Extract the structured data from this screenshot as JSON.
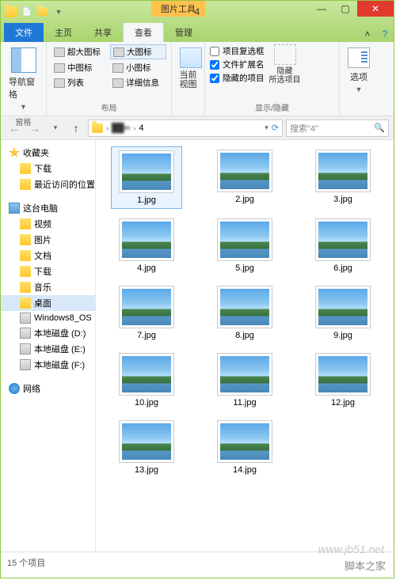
{
  "title": "4",
  "contextTab": "图片工具",
  "tabs": {
    "file": "文件",
    "home": "主页",
    "share": "共享",
    "view": "查看",
    "manage": "管理"
  },
  "ribbon": {
    "pane": {
      "nav": "导航窗格",
      "group": "窗格"
    },
    "layout": {
      "xl": "超大图标",
      "l": "大图标",
      "m": "中图标",
      "s": "小图标",
      "list": "列表",
      "detail": "详细信息",
      "group": "布局"
    },
    "curview": {
      "label": "当前\n视图"
    },
    "show": {
      "cb1": "项目复选框",
      "cb2": "文件扩展名",
      "cb3": "隐藏的项目",
      "hide": "隐藏\n所选项目",
      "group": "显示/隐藏"
    },
    "options": "选项"
  },
  "address": {
    "path1": "4",
    "sep": "›",
    "refresh": "⟳"
  },
  "search": {
    "placeholder": "搜索\"4\"",
    "icon": "🔍"
  },
  "sidebar": {
    "fav": "收藏夹",
    "downloads": "下载",
    "recent": "最近访问的位置",
    "pc": "这台电脑",
    "video": "视频",
    "pictures": "图片",
    "docs": "文档",
    "downloads2": "下载",
    "music": "音乐",
    "desktop": "桌面",
    "osdrive": "Windows8_OS",
    "driveD": "本地磁盘 (D:)",
    "driveE": "本地磁盘 (E:)",
    "driveF": "本地磁盘 (F:)",
    "network": "网络"
  },
  "files": [
    "1.jpg",
    "2.jpg",
    "3.jpg",
    "4.jpg",
    "5.jpg",
    "6.jpg",
    "7.jpg",
    "8.jpg",
    "9.jpg",
    "10.jpg",
    "11.jpg",
    "12.jpg",
    "13.jpg",
    "14.jpg"
  ],
  "status": "15 个项目",
  "watermark": "www.jb51.net",
  "watermark2": "脚本之家"
}
